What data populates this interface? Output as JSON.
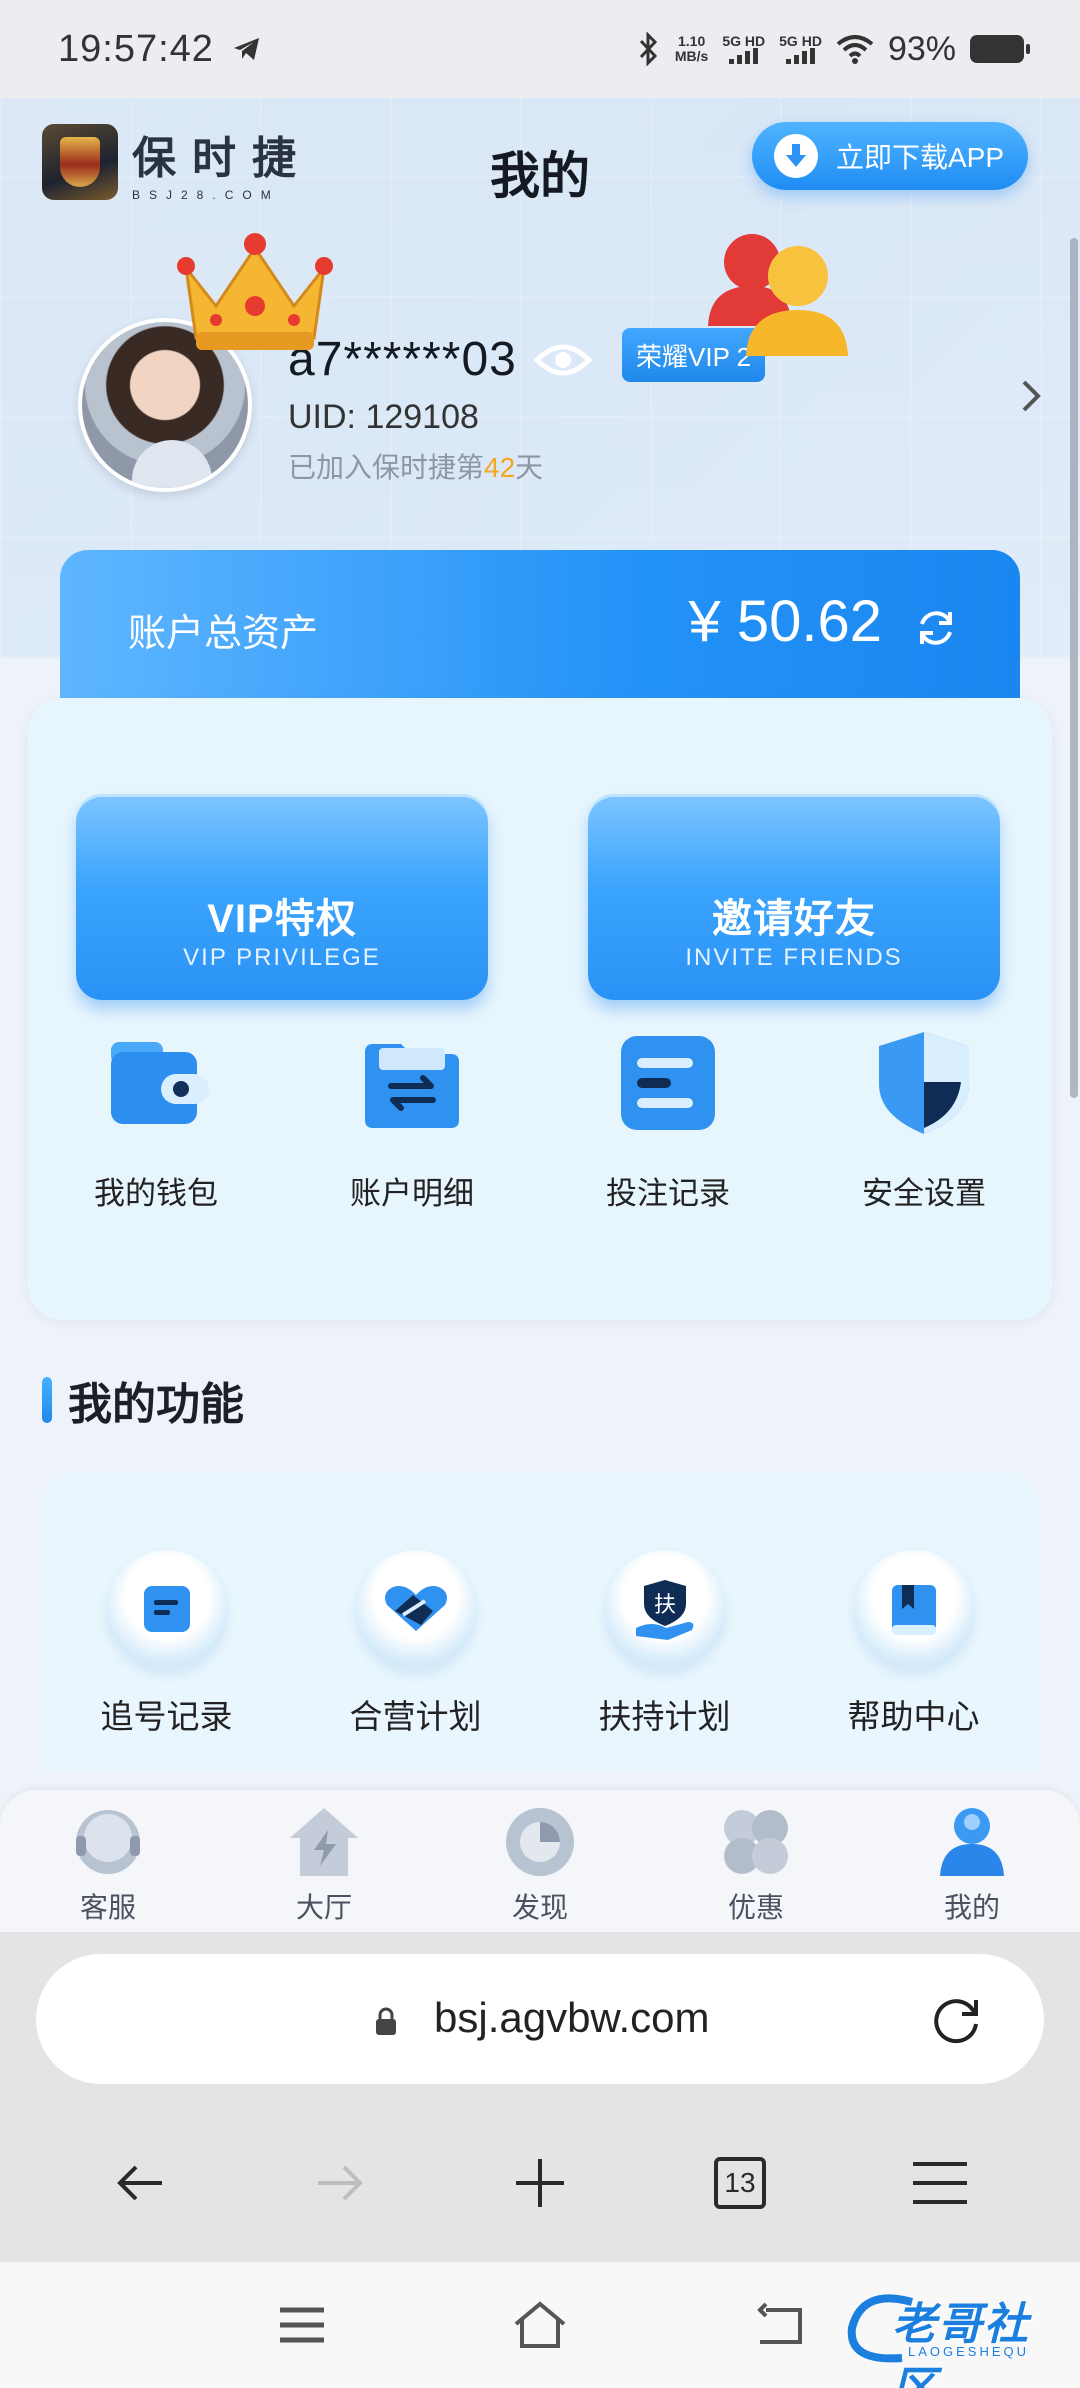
{
  "status_bar": {
    "time": "19:57:42",
    "net_speed_value": "1.10",
    "net_speed_unit": "MB/s",
    "sim1": "5G HD",
    "sim2": "5G HD",
    "battery": "93%"
  },
  "header": {
    "brand_cn": "保时捷",
    "brand_en": "BSJ28.COM",
    "title": "我的",
    "download_label": "立即下载APP"
  },
  "profile": {
    "username": "a7******03",
    "vip_badge": "荣耀VIP 2",
    "uid": "UID: 129108",
    "joined_prefix": "已加入保时捷第",
    "joined_days": "42",
    "joined_suffix": "天"
  },
  "assets": {
    "label": "账户总资产",
    "value": "¥ 50.62"
  },
  "promos": [
    {
      "title": "VIP特权",
      "subtitle": "VIP PRIVILEGE",
      "icon": "crown-icon"
    },
    {
      "title": "邀请好友",
      "subtitle": "INVITE FRIENDS",
      "icon": "friends-icon"
    }
  ],
  "quick_actions": [
    {
      "label": "我的钱包",
      "icon": "wallet-icon"
    },
    {
      "label": "账户明细",
      "icon": "folder-transfer-icon"
    },
    {
      "label": "投注记录",
      "icon": "document-list-icon"
    },
    {
      "label": "安全设置",
      "icon": "shield-icon"
    }
  ],
  "functions": {
    "title": "我的功能",
    "items": [
      {
        "label": "追号记录",
        "icon": "note-icon"
      },
      {
        "label": "合营计划",
        "icon": "handshake-icon"
      },
      {
        "label": "扶持计划",
        "icon": "support-hand-icon",
        "glyph": "扶"
      },
      {
        "label": "帮助中心",
        "icon": "book-icon"
      }
    ]
  },
  "tabbar": [
    {
      "label": "客服",
      "icon": "service-icon"
    },
    {
      "label": "大厅",
      "icon": "home-icon"
    },
    {
      "label": "发现",
      "icon": "discover-icon"
    },
    {
      "label": "优惠",
      "icon": "clover-icon"
    },
    {
      "label": "我的",
      "icon": "user-icon",
      "active": true
    }
  ],
  "browser": {
    "url": "bsj.agvbw.com",
    "tab_count": "13"
  },
  "watermark": {
    "text": "老哥社区",
    "sub": "LAOGESHEQU"
  },
  "colors": {
    "accent": "#1f8cf3",
    "asset_gradient_start": "#5fb6ff",
    "days_highlight": "#f5a623"
  }
}
